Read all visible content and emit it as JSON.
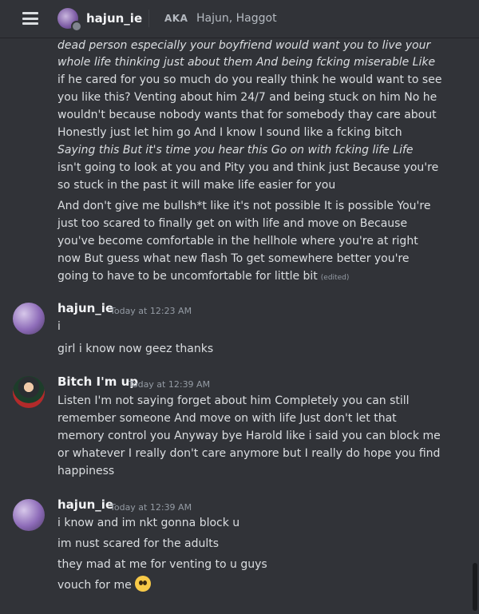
{
  "header": {
    "dm_name": "hajun_ie",
    "aka_label": "AKA",
    "aka_names": "Hajun, Haggot"
  },
  "messages": {
    "top_block": [
      "dead person especially your boyfriend would want you to live your",
      "whole life thinking just about them And being fcking miserable Like",
      "if he cared for you so much do you really think he would want to see",
      "you like this? Venting about him 24/7 and being stuck on him No he",
      "wouldn't because nobody wants that for somebody thay care about",
      "Honestly just let him go And I know I sound like a fcking bitch",
      "Saying this But it's time you hear this Go on with fcking life Life",
      "isn't going to look at you and Pity you and think just Because you're",
      "so stuck in the past it will make life easier for you"
    ],
    "second_block": [
      "And don't give me bullsh*t like it's not possible It is possible You're",
      "just too scared to finally get on with life and move on Because",
      "you've become comfortable in the hellhole where you're at right",
      "now But guess what new flash To get somewhere  better you're",
      "going to have to be uncomfortable for little bit"
    ],
    "edited_label": "(edited)",
    "msg1": {
      "author": "hajun_ie",
      "time": "Today at 12:23 AM",
      "lines": [
        "i",
        "girl i know now geez thanks"
      ]
    },
    "msg2": {
      "author": "Bitch I'm up",
      "time": "Today at 12:39 AM",
      "lines": [
        "Listen I'm not saying forget about him Completely you can still",
        "remember someone And move on with life Just don't let that",
        "memory control you Anyway bye Harold like i said you can block me",
        "or whatever I really don't care anymore but I really do hope you find",
        "happiness"
      ]
    },
    "msg3": {
      "author": "hajun_ie",
      "time": "Today at 12:39 AM",
      "lines": [
        "i know and im nkt gonna block u",
        "im nust scared for the adults",
        "they mad at me for venting to u guys",
        "vouch for me"
      ],
      "emoji": "pleading-face-emoji"
    }
  }
}
